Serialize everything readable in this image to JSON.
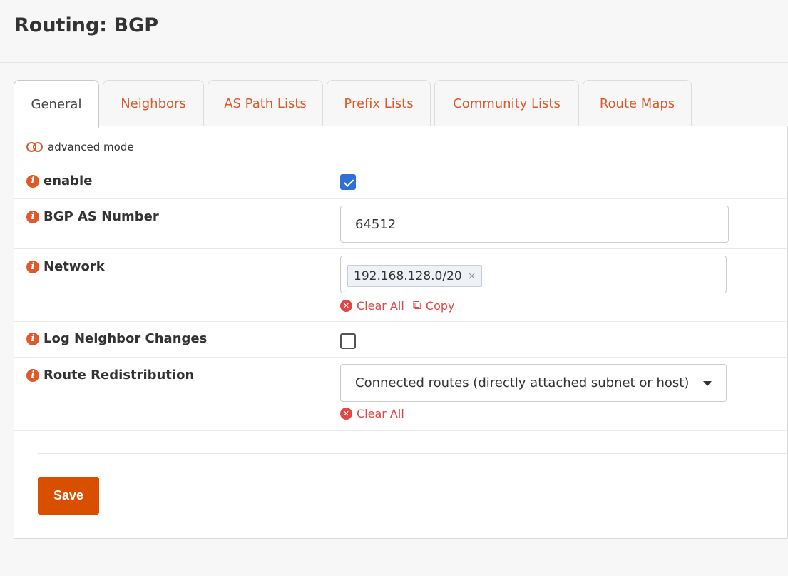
{
  "page": {
    "title": "Routing: BGP"
  },
  "tabs": [
    {
      "label": "General",
      "active": true
    },
    {
      "label": "Neighbors",
      "active": false
    },
    {
      "label": "AS Path Lists",
      "active": false
    },
    {
      "label": "Prefix Lists",
      "active": false
    },
    {
      "label": "Community Lists",
      "active": false
    },
    {
      "label": "Route Maps",
      "active": false
    }
  ],
  "advanced_mode": {
    "label": "advanced mode",
    "icon": "toggle-off-icon"
  },
  "form": {
    "enable": {
      "label": "enable",
      "checked": true
    },
    "as_number": {
      "label": "BGP AS Number",
      "value": "64512"
    },
    "network": {
      "label": "Network",
      "tags": [
        "192.168.128.0/20"
      ],
      "tag_remove": "×",
      "clear_all": "Clear All",
      "copy": "Copy"
    },
    "log_neighbor_changes": {
      "label": "Log Neighbor Changes",
      "checked": false
    },
    "route_redistribution": {
      "label": "Route Redistribution",
      "selected": "Connected routes (directly attached subnet or host)",
      "clear_all": "Clear All"
    }
  },
  "actions": {
    "save_label": "Save"
  },
  "colors": {
    "accent": "#e0592a",
    "save_button": "#d94f00",
    "danger_link": "#e04747",
    "checkbox_checked": "#2f6fd6"
  }
}
